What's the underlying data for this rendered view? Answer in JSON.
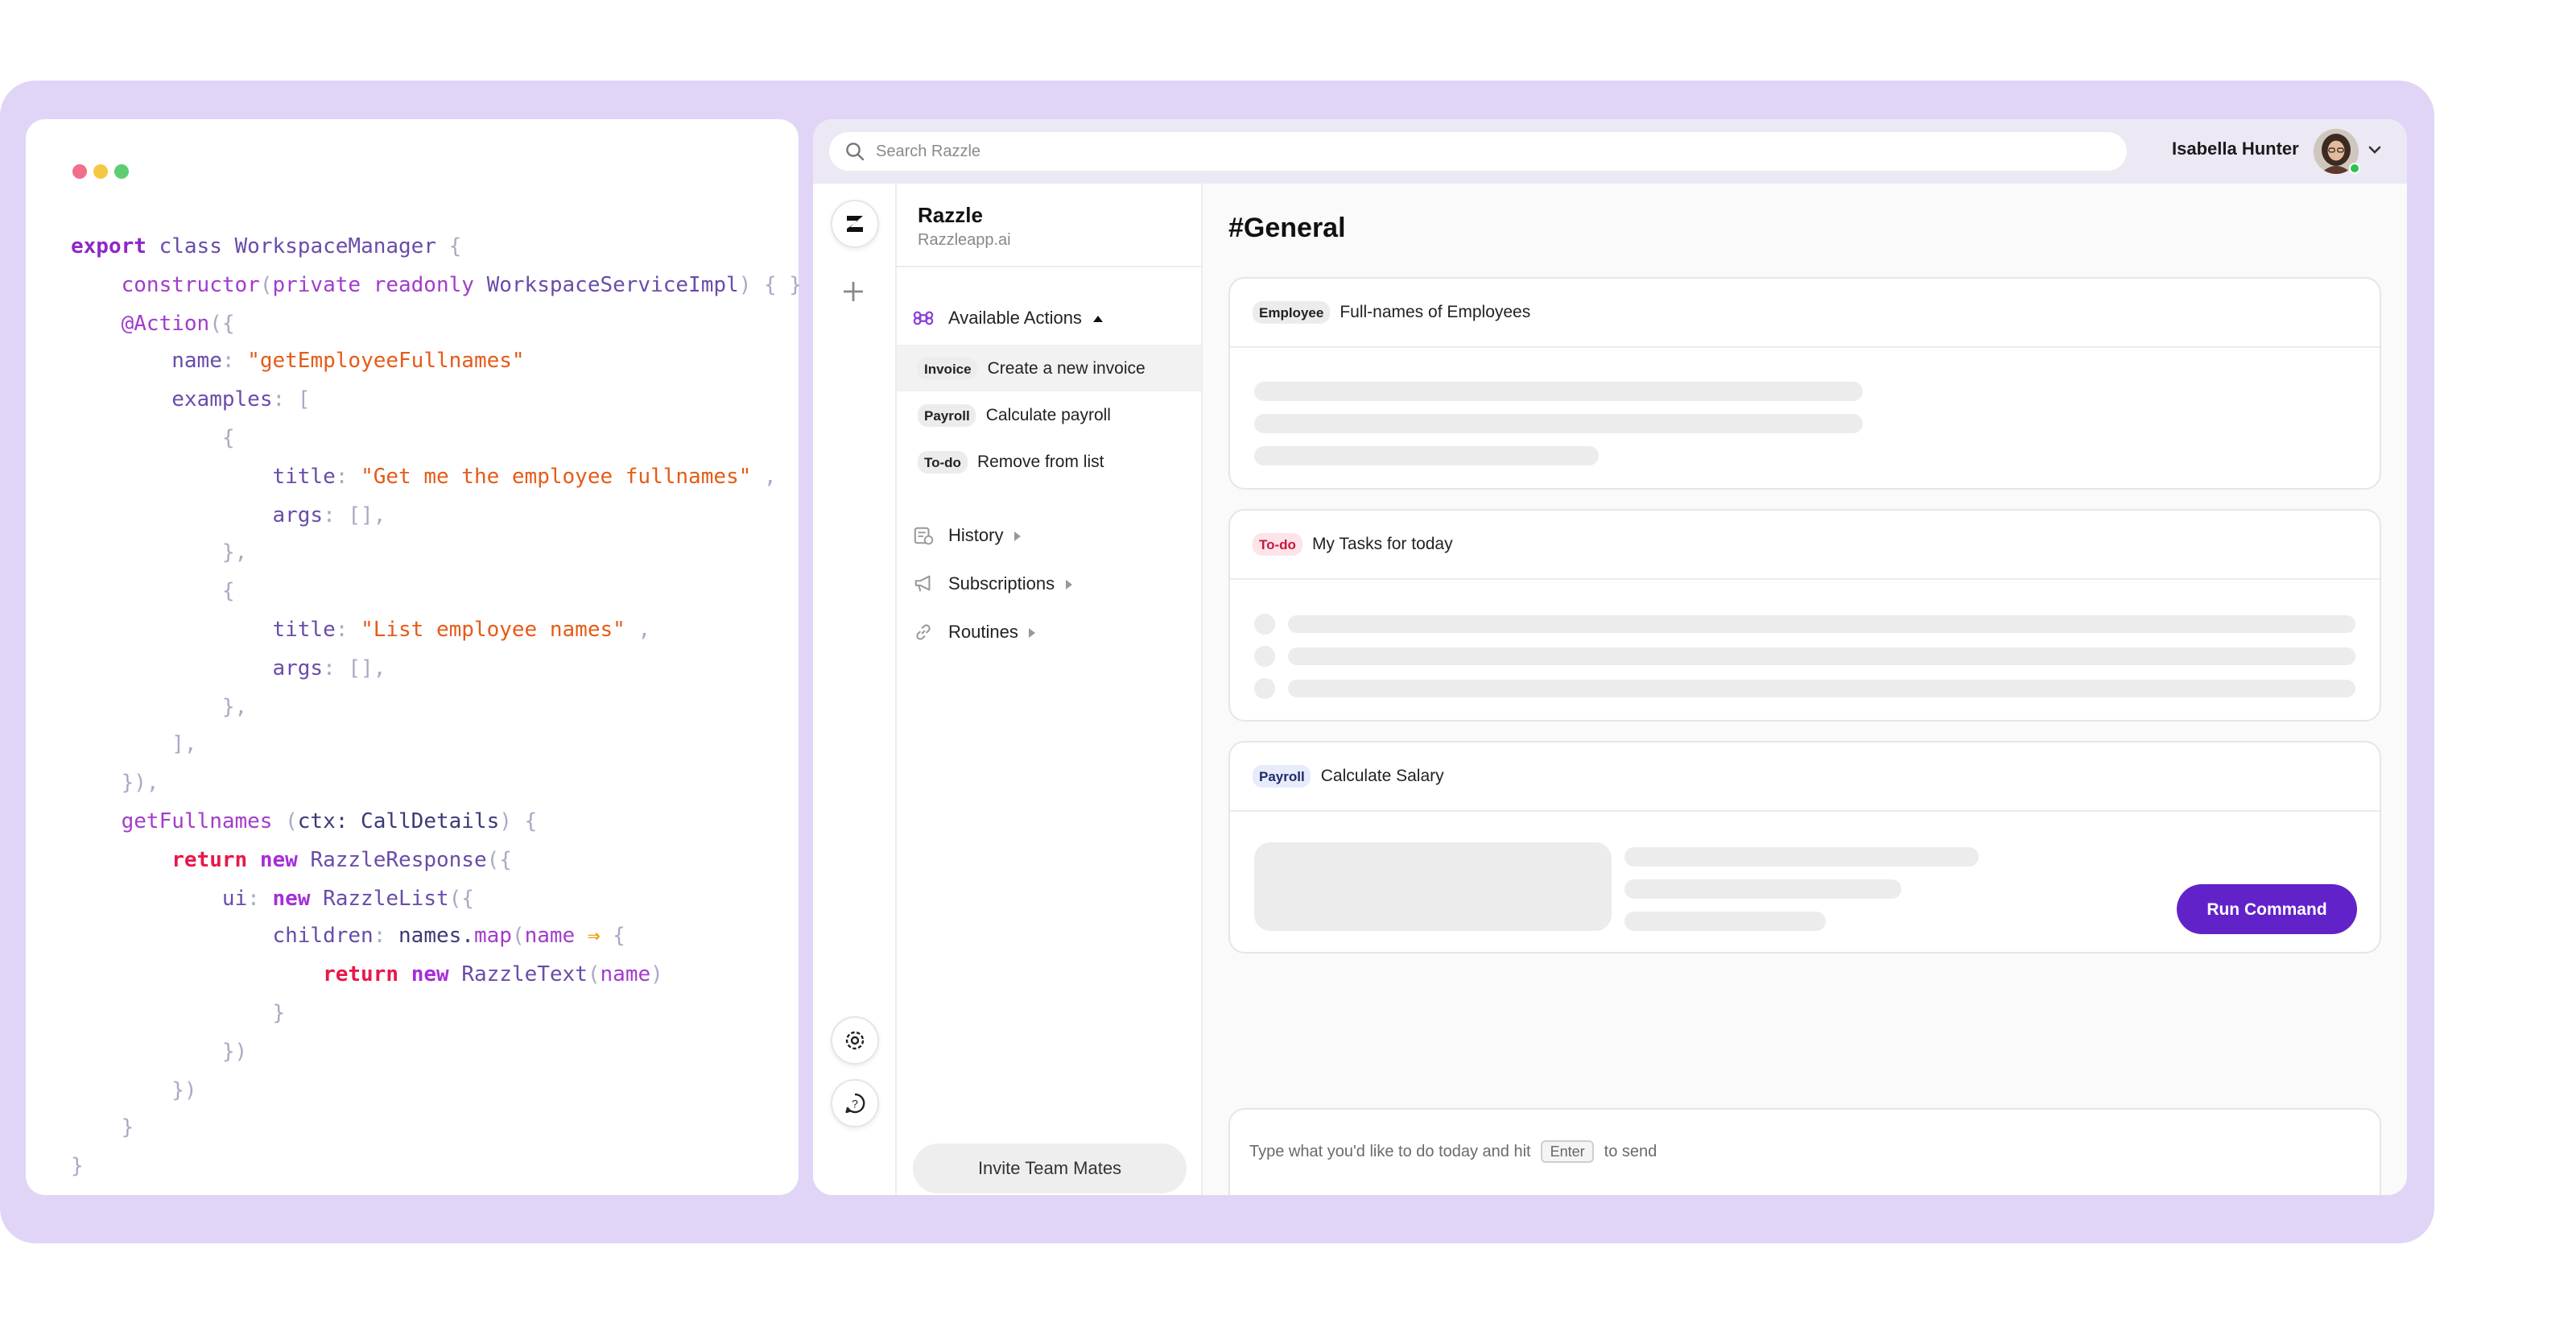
{
  "code": {
    "lines": [
      [
        [
          "kw",
          "export"
        ],
        [
          "plain",
          " "
        ],
        [
          "cls",
          "class"
        ],
        [
          "plain",
          " "
        ],
        [
          "cls",
          "WorkspaceManager"
        ],
        [
          "p",
          " {"
        ]
      ],
      [
        [
          "plain",
          "    "
        ],
        [
          "ctor",
          "constructor"
        ],
        [
          "p",
          "("
        ],
        [
          "ctor",
          "private readonly"
        ],
        [
          "plain",
          " "
        ],
        [
          "cls",
          "WorkspaceServiceImpl"
        ],
        [
          "p",
          ") { }"
        ]
      ],
      [
        [
          "plain",
          "    "
        ],
        [
          "dec",
          "@Action"
        ],
        [
          "p",
          "({"
        ]
      ],
      [
        [
          "plain",
          "        "
        ],
        [
          "prop",
          "name"
        ],
        [
          "p",
          ": "
        ],
        [
          "str",
          "\"getEmployeeFullnames\""
        ]
      ],
      [
        [
          "plain",
          "        "
        ],
        [
          "prop",
          "examples"
        ],
        [
          "p",
          ": ["
        ]
      ],
      [
        [
          "plain",
          "            "
        ],
        [
          "p",
          "{"
        ]
      ],
      [
        [
          "plain",
          "                "
        ],
        [
          "prop",
          "title"
        ],
        [
          "p",
          ": "
        ],
        [
          "str",
          "\"Get me the employee fullnames\""
        ],
        [
          "p",
          " ,"
        ]
      ],
      [
        [
          "plain",
          "                "
        ],
        [
          "prop",
          "args"
        ],
        [
          "p",
          ": [],"
        ]
      ],
      [
        [
          "plain",
          "            "
        ],
        [
          "p",
          "},"
        ]
      ],
      [
        [
          "plain",
          "            "
        ],
        [
          "p",
          "{"
        ]
      ],
      [
        [
          "plain",
          "                "
        ],
        [
          "prop",
          "title"
        ],
        [
          "p",
          ": "
        ],
        [
          "str",
          "\"List employee names\""
        ],
        [
          "p",
          " ,"
        ]
      ],
      [
        [
          "plain",
          "                "
        ],
        [
          "prop",
          "args"
        ],
        [
          "p",
          ": [],"
        ]
      ],
      [
        [
          "plain",
          "            "
        ],
        [
          "p",
          "},"
        ]
      ],
      [
        [
          "plain",
          "        "
        ],
        [
          "p",
          "],"
        ]
      ],
      [
        [
          "plain",
          "    "
        ],
        [
          "p",
          "}),"
        ]
      ],
      [
        [
          "plain",
          "    "
        ],
        [
          "fn",
          "getFullnames"
        ],
        [
          "plain",
          " "
        ],
        [
          "p",
          "("
        ],
        [
          "plain",
          "ctx: CallDetails"
        ],
        [
          "p",
          ") {"
        ]
      ],
      [
        [
          "plain",
          "        "
        ],
        [
          "ret",
          "return"
        ],
        [
          "plain",
          " "
        ],
        [
          "kw2",
          "new"
        ],
        [
          "plain",
          " "
        ],
        [
          "cls",
          "RazzleResponse"
        ],
        [
          "p",
          "({"
        ]
      ],
      [
        [
          "plain",
          "            "
        ],
        [
          "prop",
          "ui"
        ],
        [
          "p",
          ": "
        ],
        [
          "kw2",
          "new"
        ],
        [
          "plain",
          " "
        ],
        [
          "cls",
          "RazzleList"
        ],
        [
          "p",
          "({"
        ]
      ],
      [
        [
          "plain",
          "                "
        ],
        [
          "prop",
          "children"
        ],
        [
          "p",
          ": "
        ],
        [
          "plain",
          "names."
        ],
        [
          "fn",
          "map"
        ],
        [
          "p",
          "("
        ],
        [
          "fn",
          "name"
        ],
        [
          "plain",
          " "
        ],
        [
          "arrow",
          "⇒"
        ],
        [
          "p",
          " {"
        ]
      ],
      [
        [
          "plain",
          "                    "
        ],
        [
          "ret",
          "return"
        ],
        [
          "plain",
          " "
        ],
        [
          "kw2",
          "new"
        ],
        [
          "plain",
          " "
        ],
        [
          "cls",
          "RazzleText"
        ],
        [
          "p",
          "("
        ],
        [
          "fn",
          "name"
        ],
        [
          "p",
          ")"
        ]
      ],
      [
        [
          "plain",
          "                "
        ],
        [
          "p",
          "}"
        ]
      ],
      [
        [
          "plain",
          "            "
        ],
        [
          "p",
          "})"
        ]
      ],
      [
        [
          "plain",
          "        "
        ],
        [
          "p",
          "})"
        ]
      ],
      [
        [
          "plain",
          "    "
        ],
        [
          "p",
          "}"
        ]
      ],
      [
        [
          "p",
          "}"
        ]
      ]
    ]
  },
  "window_dots": [
    "#ef6f8d",
    "#f5c842",
    "#5dce6f"
  ],
  "topbar": {
    "search_placeholder": "Search Razzle",
    "user_name": "Isabella Hunter"
  },
  "workspace": {
    "name": "Razzle",
    "domain": "Razzleapp.ai"
  },
  "sidebar": {
    "actions_label": "Available Actions",
    "actions": [
      {
        "tag": "Invoice",
        "label": "Create a new invoice"
      },
      {
        "tag": "Payroll",
        "label": "Calculate payroll"
      },
      {
        "tag": "To-do",
        "label": "Remove from list"
      }
    ],
    "sections": [
      {
        "label": "History",
        "icon": "history-icon"
      },
      {
        "label": "Subscriptions",
        "icon": "megaphone-icon"
      },
      {
        "label": "Routines",
        "icon": "link-icon"
      }
    ],
    "invite_label": "Invite Team Mates"
  },
  "channel": {
    "title": "#General",
    "cards": [
      {
        "tag": "Employee",
        "title": "Full-names of Employees"
      },
      {
        "tag": "To-do",
        "title": "My Tasks for today"
      },
      {
        "tag": "Payroll",
        "title": "Calculate Salary",
        "button": "Run Command"
      }
    ]
  },
  "composer": {
    "text_before": "Type what you'd like to do today and hit",
    "key": "Enter",
    "text_after": "to send",
    "icons": [
      "paperclip-icon",
      "at-icon",
      "emoji-icon"
    ]
  },
  "colors": {
    "frame": "#e0d5f7",
    "accent": "#6222c9",
    "action_icon": "#8a3fdc"
  }
}
